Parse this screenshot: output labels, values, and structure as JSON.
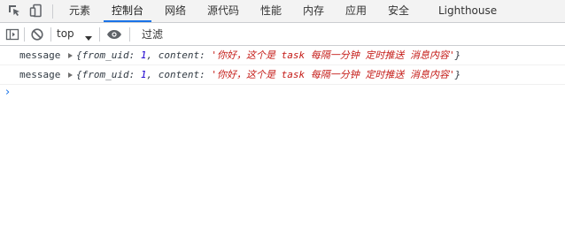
{
  "tabs": [
    {
      "label": "元素"
    },
    {
      "label": "控制台"
    },
    {
      "label": "网络"
    },
    {
      "label": "源代码"
    },
    {
      "label": "性能"
    },
    {
      "label": "内存"
    },
    {
      "label": "应用"
    },
    {
      "label": "安全"
    },
    {
      "label": "Lighthouse"
    }
  ],
  "active_tab": "控制台",
  "toolbar": {
    "context": "top",
    "filter_placeholder": "过滤"
  },
  "messages": [
    {
      "label": "message",
      "open": "{",
      "k1": "from_uid",
      "sep1": ": ",
      "v1": "1",
      "comma": ", ",
      "k2": "content",
      "sep2": ": ",
      "v2": "'你好，这个是 task 每隔一分钟 定时推送 消息内容'",
      "close": "}"
    },
    {
      "label": "message",
      "open": "{",
      "k1": "from_uid",
      "sep1": ": ",
      "v1": "1",
      "comma": ", ",
      "k2": "content",
      "sep2": ": ",
      "v2": "'你好，这个是 task 每隔一分钟 定时推送 消息内容'",
      "close": "}"
    }
  ],
  "prompt": "›"
}
